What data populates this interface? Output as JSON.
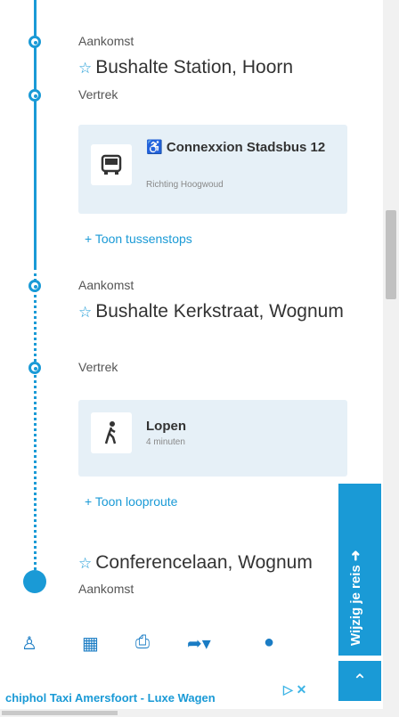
{
  "stops": [
    {
      "type_label": "Aankomst",
      "name": "Bushalte Station, Hoorn"
    },
    {
      "type_label": "Vertrek"
    },
    {
      "type_label": "Aankomst",
      "name": "Bushalte Kerkstraat, Wognum"
    },
    {
      "type_label": "Vertrek"
    },
    {
      "name": "Conferencelaan, Wognum",
      "type_label": "Aankomst"
    }
  ],
  "legs": [
    {
      "title": "Connexxion Stadsbus 12",
      "subtitle": "Richting Hoogwoud",
      "icon": "bus-icon"
    },
    {
      "title": "Lopen",
      "subtitle": "4 minuten",
      "icon": "walk-icon"
    }
  ],
  "links": {
    "show_stops": "Toon tussenstops",
    "show_route": "Toon looproute"
  },
  "side": {
    "edit_trip": "Wijzig je reis"
  },
  "ad": {
    "text": "chiphol Taxi Amersfoort - Luxe Wagen"
  },
  "colors": {
    "accent": "#1a9ad6",
    "card": "#e6f0f7"
  }
}
